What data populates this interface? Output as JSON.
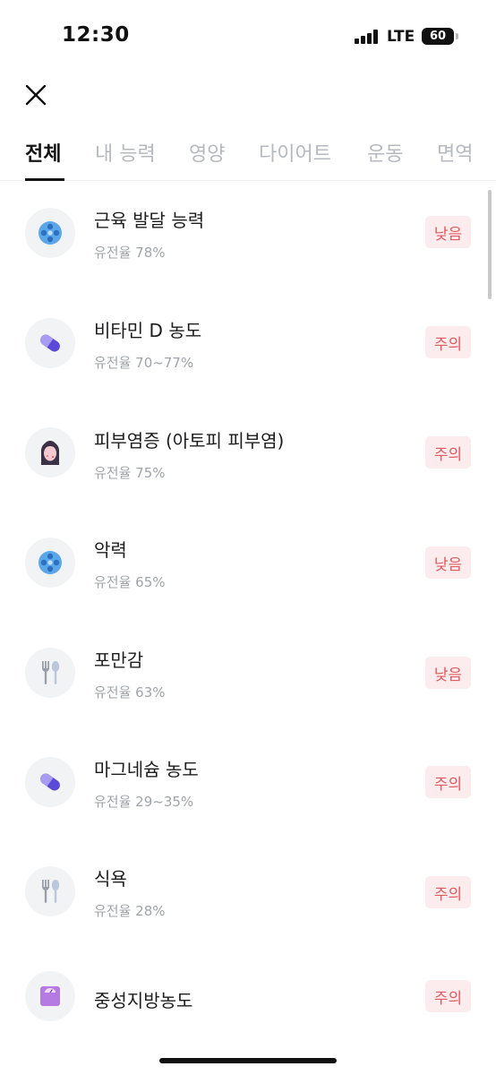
{
  "status_bar": {
    "time": "12:30",
    "network": "LTE",
    "battery": "60",
    "signal_icon": "signal-bars-icon"
  },
  "close_icon": "close-icon",
  "tabs": [
    {
      "label": "전체",
      "active": true
    },
    {
      "label": "내 능력",
      "active": false
    },
    {
      "label": "영양",
      "active": false
    },
    {
      "label": "다이어트",
      "active": false
    },
    {
      "label": "운동",
      "active": false
    },
    {
      "label": "면역",
      "active": false
    }
  ],
  "items": [
    {
      "title": "근육 발달 능력",
      "subtitle": "유전율 78%",
      "badge": "낮음",
      "icon": "soccer-ball-icon"
    },
    {
      "title": "비타민 D 농도",
      "subtitle": "유전율 70~77%",
      "badge": "주의",
      "icon": "pill-icon"
    },
    {
      "title": "피부염증 (아토피 피부염)",
      "subtitle": "유전율 75%",
      "badge": "주의",
      "icon": "woman-face-icon"
    },
    {
      "title": "악력",
      "subtitle": "유전율 65%",
      "badge": "낮음",
      "icon": "soccer-ball-icon"
    },
    {
      "title": "포만감",
      "subtitle": "유전율 63%",
      "badge": "낮음",
      "icon": "fork-spoon-icon"
    },
    {
      "title": "마그네슘 농도",
      "subtitle": "유전율 29~35%",
      "badge": "주의",
      "icon": "pill-icon"
    },
    {
      "title": "식욕",
      "subtitle": "유전율 28%",
      "badge": "주의",
      "icon": "fork-spoon-icon"
    },
    {
      "title": "중성지방농도",
      "subtitle": "",
      "badge": "주의",
      "icon": "scale-icon"
    }
  ],
  "colors": {
    "badge_bg": "#fdecee",
    "badge_text": "#e15a5f",
    "tab_inactive": "#b6b9c0",
    "subtitle": "#9fa3ab"
  }
}
